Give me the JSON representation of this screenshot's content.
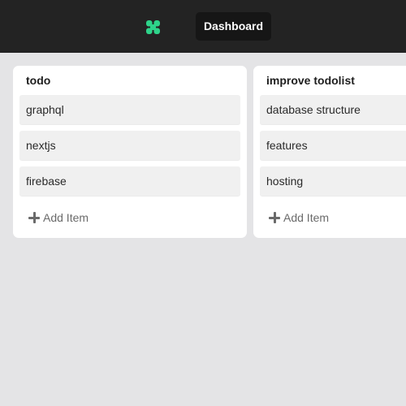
{
  "header": {
    "logo_icon": "clover-icon",
    "accent_color": "#2ed38a",
    "nav_button_label": "Dashboard"
  },
  "board": {
    "columns": [
      {
        "title": "todo",
        "items": [
          "graphql",
          "nextjs",
          "firebase"
        ],
        "add_item_label": "Add Item"
      },
      {
        "title": "improve todolist",
        "items": [
          "database structure",
          "features",
          "hosting"
        ],
        "add_item_label": "Add Item"
      }
    ]
  }
}
